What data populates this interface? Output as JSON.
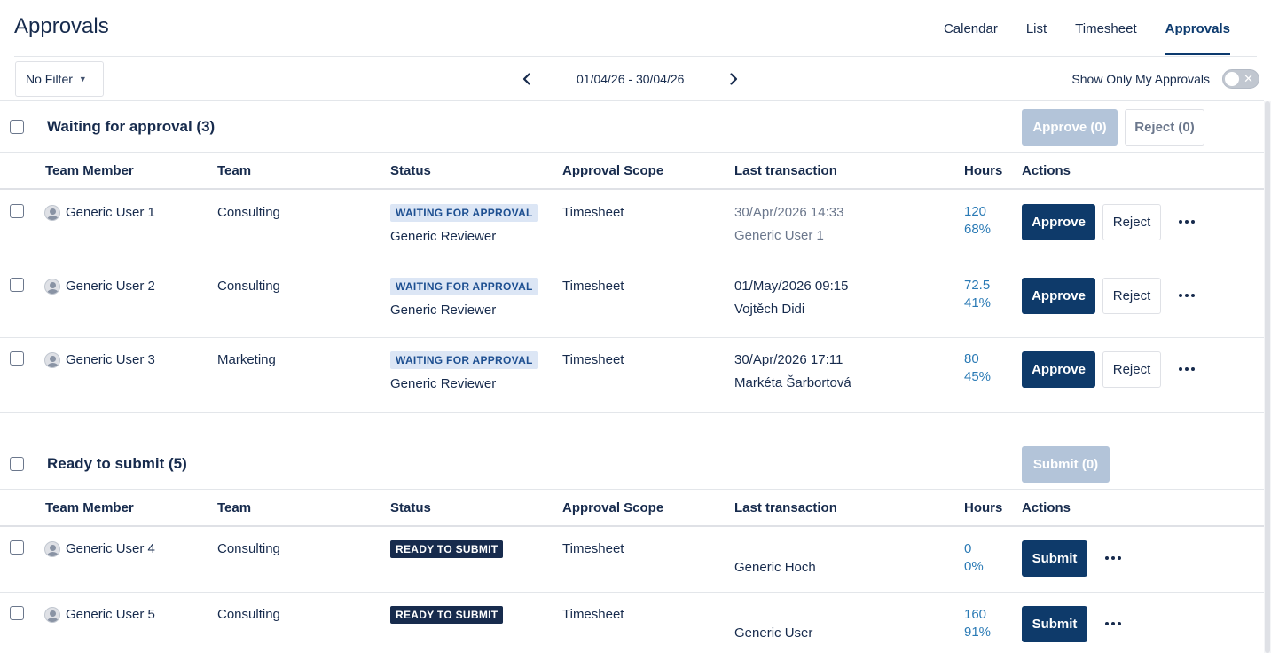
{
  "page_title": "Approvals",
  "nav": {
    "tabs": [
      "Calendar",
      "List",
      "Timesheet",
      "Approvals"
    ],
    "active": "Approvals"
  },
  "toolbar": {
    "filter_label": "No Filter",
    "date_range": "01/04/26 - 30/04/26",
    "toggle_label": "Show Only My Approvals",
    "toggle_on": false
  },
  "columns": [
    "Team Member",
    "Team",
    "Status",
    "Approval Scope",
    "Last transaction",
    "Hours",
    "Actions"
  ],
  "waiting": {
    "title": "Waiting for approval (3)",
    "approve_all": "Approve (0)",
    "reject_all": "Reject (0)",
    "rows": [
      {
        "member": "Generic User 1",
        "team": "Consulting",
        "status": "WAITING FOR APPROVAL",
        "reviewer": "Generic Reviewer",
        "scope": "Timesheet",
        "tx_date": "30/Apr/2026 14:33",
        "tx_user": "Generic User 1",
        "hours": "120",
        "percent": "68%",
        "approve": "Approve",
        "reject": "Reject"
      },
      {
        "member": "Generic User 2",
        "team": "Consulting",
        "status": "WAITING FOR APPROVAL",
        "reviewer": "Generic Reviewer",
        "scope": "Timesheet",
        "tx_date": "01/May/2026 09:15",
        "tx_user": "Vojtěch Didi",
        "hours": "72.5",
        "percent": "41%",
        "approve": "Approve",
        "reject": "Reject"
      },
      {
        "member": "Generic User 3",
        "team": "Marketing",
        "status": "WAITING FOR APPROVAL",
        "reviewer": "Generic Reviewer",
        "scope": "Timesheet",
        "tx_date": "30/Apr/2026 17:11",
        "tx_user": "Markéta Šarbortová",
        "hours": "80",
        "percent": "45%",
        "approve": "Approve",
        "reject": "Reject"
      }
    ]
  },
  "ready": {
    "title": "Ready to submit (5)",
    "submit_all": "Submit (0)",
    "rows": [
      {
        "member": "Generic User 4",
        "team": "Consulting",
        "status": "READY TO SUBMIT",
        "scope": "Timesheet",
        "tx_user": "Generic Hoch",
        "hours": "0",
        "percent": "0%",
        "submit": "Submit"
      },
      {
        "member": "Generic User 5",
        "team": "Consulting",
        "status": "READY TO SUBMIT",
        "scope": "Timesheet",
        "tx_user": "Generic User",
        "hours": "160",
        "percent": "91%",
        "submit": "Submit"
      }
    ]
  }
}
